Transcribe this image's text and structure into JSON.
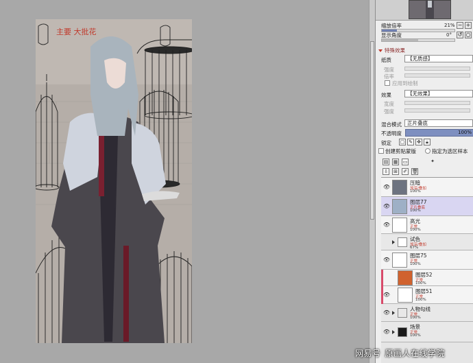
{
  "canvas": {
    "artwork_annotation": "主要 大批花"
  },
  "navigator": {
    "zoom_label": "缩放倍率",
    "zoom_value": "21%",
    "zoom_fraction": 0.21,
    "angle_label": "显示角度",
    "angle_value": "0°",
    "angle_fraction": 0.5
  },
  "effects": {
    "section_title": "特殊效果",
    "texture_label": "纸质",
    "texture_value": "【无质感】",
    "texture_scale_label": "强度",
    "texture_contrast_label": "倍率",
    "texture_checkbox_label": "应用到绘制",
    "effect_label": "效果",
    "effect_value": "【无效果】",
    "effect_width_label": "宽度",
    "effect_strength_label": "强度"
  },
  "blend": {
    "mode_label": "混合模式",
    "mode_value": "正片叠底",
    "opacity_label": "不透明度",
    "opacity_value": "100%",
    "opacity_fraction": 1.0,
    "lock_label": "锁定",
    "clip_label": "创建剪贴蒙版",
    "selection_source_label": "指定为选区样本"
  },
  "layers": [
    {
      "name": "压暗",
      "mode": "加深/叠加",
      "opacity": "100%",
      "thumb": "#6d7380",
      "eye": true,
      "selected": false,
      "folder": false,
      "clip": false,
      "indent": 0
    },
    {
      "name": "图层77",
      "mode": "正片叠底",
      "opacity": "100%",
      "thumb": "#9eb0c6",
      "eye": true,
      "selected": true,
      "folder": false,
      "clip": false,
      "indent": 0
    },
    {
      "name": "高光",
      "mode": "正常",
      "opacity": "100%",
      "thumb": "#ffffff",
      "eye": true,
      "selected": false,
      "folder": false,
      "clip": false,
      "indent": 0
    },
    {
      "name": "试色",
      "mode": "加深/叠加",
      "opacity": "67%",
      "thumb": "#ffffff",
      "eye": false,
      "selected": false,
      "folder": true,
      "clip": false,
      "indent": 0
    },
    {
      "name": "图层75",
      "mode": "正常",
      "opacity": "100%",
      "thumb": "#ffffff",
      "eye": true,
      "selected": false,
      "folder": false,
      "clip": false,
      "indent": 0
    },
    {
      "name": "图层52",
      "mode": "正常",
      "opacity": "100%",
      "thumb": "#d0622e",
      "eye": false,
      "selected": false,
      "folder": false,
      "clip": true,
      "indent": 8
    },
    {
      "name": "图层51",
      "mode": "正常",
      "opacity": "100%",
      "thumb": "#ffffff",
      "eye": true,
      "selected": false,
      "folder": false,
      "clip": true,
      "indent": 8
    },
    {
      "name": "人物勾线",
      "mode": "正常",
      "opacity": "100%",
      "thumb": "#e8e8e8",
      "eye": true,
      "selected": false,
      "folder": true,
      "clip": false,
      "indent": 0
    },
    {
      "name": "场景",
      "mode": "正常",
      "opacity": "100%",
      "thumb": "#1a1a1a",
      "eye": true,
      "selected": false,
      "folder": true,
      "clip": false,
      "indent": 0
    }
  ],
  "watermark": {
    "brand": "网易号",
    "text": "原画人在线学院"
  },
  "colors": {
    "accent": "#7e8fc0",
    "selected_layer": "#d9d6f2",
    "clip_marker": "#d84a6a",
    "mode_text": "#c0392b"
  }
}
